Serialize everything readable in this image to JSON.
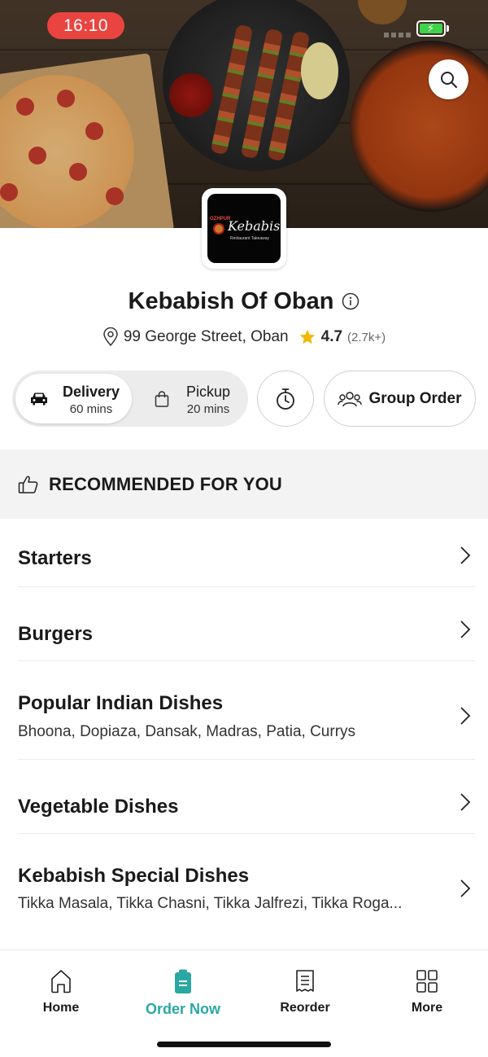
{
  "status_bar": {
    "time": "16:10",
    "battery_color": "#3fd24a",
    "time_pill_color": "#ea4440"
  },
  "hero": {
    "search_icon": "search-icon"
  },
  "restaurant": {
    "logo_name": "Kebabish",
    "logo_tagline": "Restaurant Takeaway",
    "logo_arc": "OZHPUR",
    "name": "Kebabish Of Oban",
    "address": "99 George Street, Oban",
    "rating": "4.7",
    "rating_count": "(2.7k+)"
  },
  "order_modes": {
    "delivery": {
      "label": "Delivery",
      "time": "60 mins"
    },
    "pickup": {
      "label": "Pickup",
      "time": "20 mins"
    },
    "group_order_label": "Group Order"
  },
  "recommended": {
    "label": "RECOMMENDED FOR YOU"
  },
  "categories": [
    {
      "title": "Starters",
      "desc": ""
    },
    {
      "title": "Burgers",
      "desc": ""
    },
    {
      "title": "Popular Indian Dishes",
      "desc": "Bhoona, Dopiaza, Dansak, Madras, Patia, Currys"
    },
    {
      "title": "Vegetable Dishes",
      "desc": ""
    },
    {
      "title": "Kebabish Special Dishes",
      "desc": "Tikka Masala, Tikka Chasni, Tikka Jalfrezi, Tikka Roga..."
    }
  ],
  "bottom_nav": {
    "home": "Home",
    "order_now": "Order Now",
    "reorder": "Reorder",
    "more": "More",
    "accent_color": "#2aa8a3"
  }
}
